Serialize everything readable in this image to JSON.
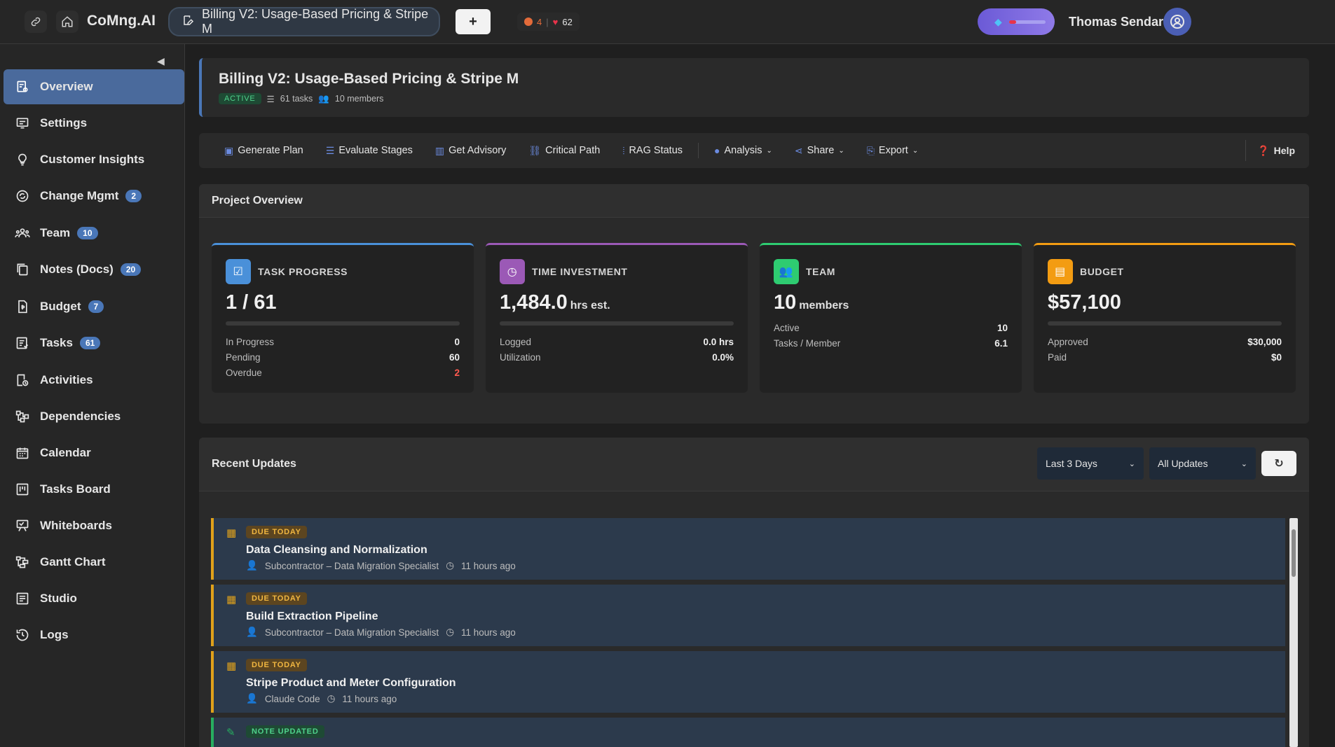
{
  "topbar": {
    "brand": "CoMng.AI",
    "project_tab": "Billing V2: Usage-Based Pricing & Stripe M",
    "add_label": "+",
    "stat_count": "4",
    "likes": "62",
    "user_name": "Thomas Sendar"
  },
  "sidebar": {
    "items": [
      {
        "label": "Overview",
        "icon": "overview-icon",
        "badge": ""
      },
      {
        "label": "Settings",
        "icon": "settings-icon",
        "badge": ""
      },
      {
        "label": "Customer Insights",
        "icon": "lightbulb-icon",
        "badge": ""
      },
      {
        "label": "Change Mgmt",
        "icon": "change-icon",
        "badge": "2"
      },
      {
        "label": "Team",
        "icon": "team-icon",
        "badge": "10"
      },
      {
        "label": "Notes (Docs)",
        "icon": "notes-icon",
        "badge": "20"
      },
      {
        "label": "Budget",
        "icon": "budget-icon",
        "badge": "7"
      },
      {
        "label": "Tasks",
        "icon": "tasks-icon",
        "badge": "61"
      },
      {
        "label": "Activities",
        "icon": "activities-icon",
        "badge": ""
      },
      {
        "label": "Dependencies",
        "icon": "dependencies-icon",
        "badge": ""
      },
      {
        "label": "Calendar",
        "icon": "calendar-icon",
        "badge": ""
      },
      {
        "label": "Tasks Board",
        "icon": "board-icon",
        "badge": ""
      },
      {
        "label": "Whiteboards",
        "icon": "whiteboard-icon",
        "badge": ""
      },
      {
        "label": "Gantt Chart",
        "icon": "gantt-icon",
        "badge": ""
      },
      {
        "label": "Studio",
        "icon": "studio-icon",
        "badge": ""
      },
      {
        "label": "Logs",
        "icon": "logs-icon",
        "badge": ""
      }
    ]
  },
  "header": {
    "title": "Billing V2: Usage-Based Pricing & Stripe M",
    "status": "ACTIVE",
    "tasks": "61 tasks",
    "members": "10 members"
  },
  "toolbar": {
    "generate_plan": "Generate Plan",
    "evaluate_stages": "Evaluate Stages",
    "get_advisory": "Get Advisory",
    "critical_path": "Critical Path",
    "rag_status": "RAG Status",
    "analysis": "Analysis",
    "share": "Share",
    "export": "Export",
    "help": "Help"
  },
  "overview": {
    "title": "Project Overview",
    "task_progress": {
      "label": "TASK PROGRESS",
      "value": "1 / 61",
      "rows": [
        {
          "label": "In Progress",
          "value": "0"
        },
        {
          "label": "Pending",
          "value": "60"
        },
        {
          "label": "Overdue",
          "value": "2"
        }
      ]
    },
    "time_investment": {
      "label": "TIME INVESTMENT",
      "value": "1,484.0",
      "unit": "hrs est.",
      "rows": [
        {
          "label": "Logged",
          "value": "0.0 hrs"
        },
        {
          "label": "Utilization",
          "value": "0.0%"
        }
      ]
    },
    "team": {
      "label": "TEAM",
      "value": "10",
      "unit": "members",
      "rows": [
        {
          "label": "Active",
          "value": "10"
        },
        {
          "label": "Tasks / Member",
          "value": "6.1"
        }
      ]
    },
    "budget": {
      "label": "BUDGET",
      "value": "$57,100",
      "rows": [
        {
          "label": "Approved",
          "value": "$30,000"
        },
        {
          "label": "Paid",
          "value": "$0"
        }
      ]
    }
  },
  "updates": {
    "title": "Recent Updates",
    "range_filter": "Last 3 Days",
    "type_filter": "All Updates",
    "items": [
      {
        "tag": "DUE TODAY",
        "title": "Data Cleansing and Normalization",
        "author": "Subcontractor – Data Migration Specialist",
        "time": "11 hours ago"
      },
      {
        "tag": "DUE TODAY",
        "title": "Build Extraction Pipeline",
        "author": "Subcontractor – Data Migration Specialist",
        "time": "11 hours ago"
      },
      {
        "tag": "DUE TODAY",
        "title": "Stripe Product and Meter Configuration",
        "author": "Claude Code",
        "time": "11 hours ago"
      },
      {
        "tag": "NOTE UPDATED",
        "title": "",
        "author": "",
        "time": ""
      }
    ]
  },
  "colors": {
    "accent_blue": "#4a77b8",
    "task_progress": "#4a90d9",
    "time_investment": "#9b59b6",
    "team": "#2ecc71",
    "budget": "#f39c12",
    "due_today": "#e0a11b",
    "note_updated": "#27ae60"
  }
}
